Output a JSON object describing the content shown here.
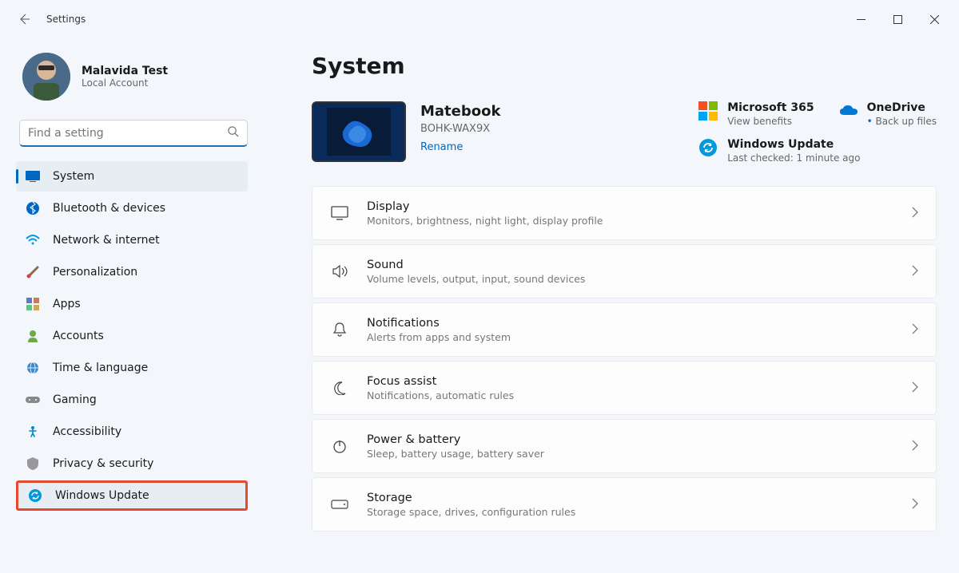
{
  "app_title": "Settings",
  "profile": {
    "name": "Malavida Test",
    "subtitle": "Local Account"
  },
  "search": {
    "placeholder": "Find a setting"
  },
  "nav": {
    "system": "System",
    "bluetooth": "Bluetooth & devices",
    "network": "Network & internet",
    "personalization": "Personalization",
    "apps": "Apps",
    "accounts": "Accounts",
    "time": "Time & language",
    "gaming": "Gaming",
    "accessibility": "Accessibility",
    "privacy": "Privacy & security",
    "update": "Windows Update"
  },
  "page_title": "System",
  "device": {
    "name": "Matebook",
    "model": "BOHK-WAX9X",
    "rename": "Rename"
  },
  "cloud": {
    "ms365": {
      "title": "Microsoft 365",
      "sub": "View benefits"
    },
    "onedrive": {
      "title": "OneDrive",
      "sub": "Back up files"
    },
    "winupdate": {
      "title": "Windows Update",
      "sub": "Last checked: 1 minute ago"
    }
  },
  "cards": {
    "display": {
      "title": "Display",
      "sub": "Monitors, brightness, night light, display profile"
    },
    "sound": {
      "title": "Sound",
      "sub": "Volume levels, output, input, sound devices"
    },
    "notifications": {
      "title": "Notifications",
      "sub": "Alerts from apps and system"
    },
    "focus": {
      "title": "Focus assist",
      "sub": "Notifications, automatic rules"
    },
    "power": {
      "title": "Power & battery",
      "sub": "Sleep, battery usage, battery saver"
    },
    "storage": {
      "title": "Storage",
      "sub": "Storage space, drives, configuration rules"
    }
  }
}
